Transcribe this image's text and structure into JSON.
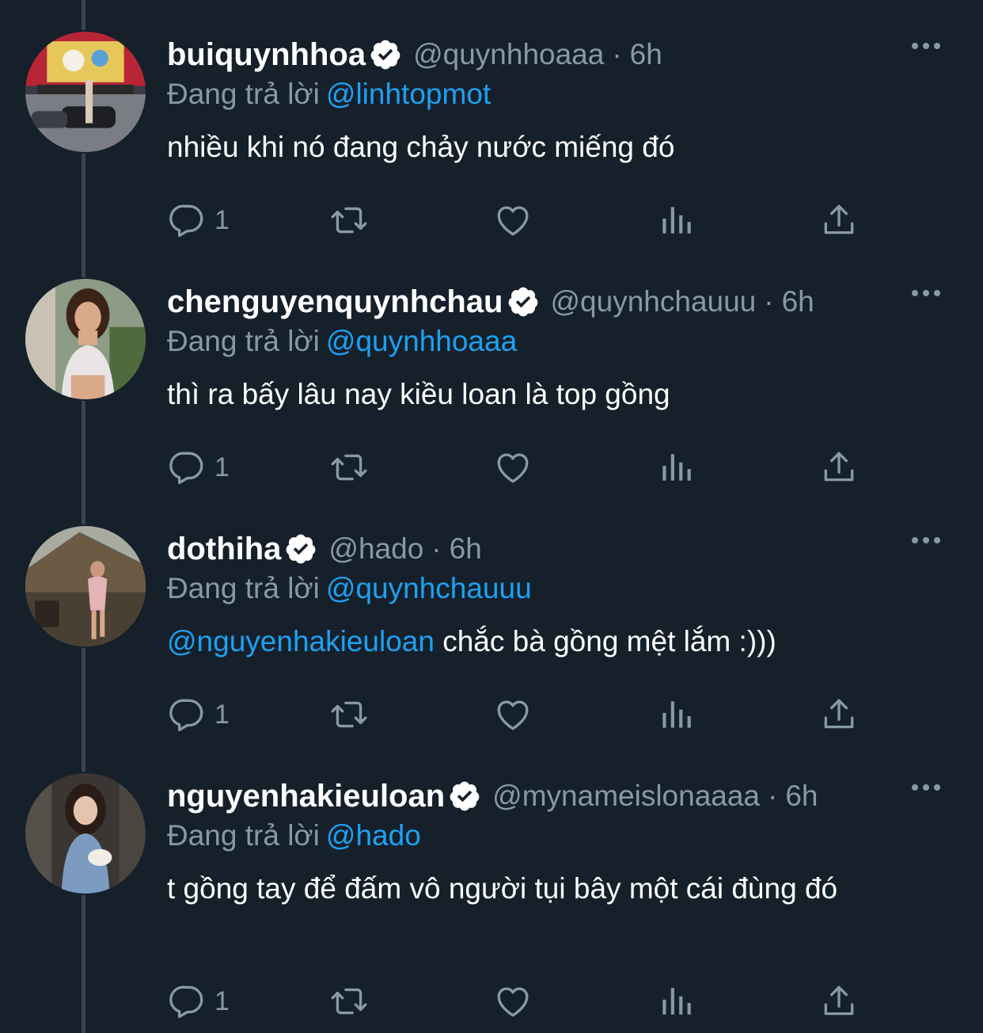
{
  "theme": {
    "background": "#15202b",
    "text": "#ffffff",
    "muted": "#8899a6",
    "link": "#1da1f2",
    "thread_line": "#38444d"
  },
  "reply_prefix": "Đang trả lời",
  "icons": {
    "reply": "comment-icon",
    "retweet": "retweet-icon",
    "like": "heart-icon",
    "views": "analytics-icon",
    "share": "share-icon",
    "verified": "verified-badge-icon",
    "more": "more-options-icon"
  },
  "tweets": [
    {
      "name": "buiquynhhoa",
      "handle": "@quynhhoaaa",
      "separator": "·",
      "time": "6h",
      "replying_to": "@linhtopmot",
      "mention": "",
      "text": "nhiều khi nó đang chảy nước miếng đó",
      "reply_count": "1"
    },
    {
      "name": "chenguyenquynhchau",
      "handle": "@quynhchauuu",
      "separator": "·",
      "time": "6h",
      "replying_to": "@quynhhoaaa",
      "mention": "",
      "text": "thì ra bấy lâu nay kiều loan là top gồng",
      "reply_count": "1"
    },
    {
      "name": "dothiha",
      "handle": "@hado",
      "separator": "·",
      "time": "6h",
      "replying_to": "@quynhchauuu",
      "mention": "@nguyenhakieuloan",
      "text": " chắc bà gồng mệt lắm :)))",
      "reply_count": "1"
    },
    {
      "name": "nguyenhakieuloan",
      "handle": "@mynameislonaaaa",
      "separator": "·",
      "time": "6h",
      "replying_to": "@hado",
      "mention": "",
      "text": "t gồng tay để đấm vô người tụi bây một cái đùng đó",
      "reply_count": "1"
    }
  ]
}
